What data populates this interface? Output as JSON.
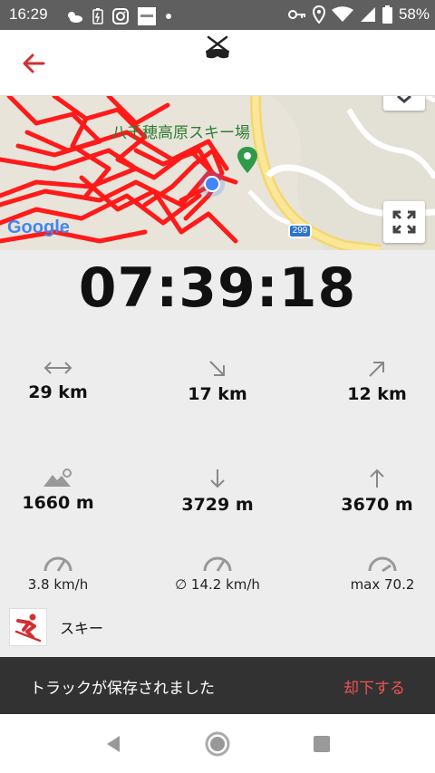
{
  "status_bar": {
    "time": "16:29",
    "battery": "58%",
    "left_icons": [
      "weather-icon",
      "battery-saver-icon",
      "instagram-icon",
      "app-icon",
      "dot-icon"
    ],
    "right_icons": [
      "key-icon",
      "location-icon",
      "wifi-icon",
      "signal-icon",
      "battery-icon"
    ]
  },
  "header": {
    "back_icon": "arrow-left-icon",
    "logo_icon": "ski-goggles-logo-icon"
  },
  "map": {
    "place_label": "八千穂高原スキー場",
    "google_label": "Google",
    "route_number": "299",
    "expand_icon": "fullscreen-icon"
  },
  "timer": "07:39:18",
  "stats": {
    "distance": "29 km",
    "downhill_distance": "17 km",
    "uphill_distance": "12 km",
    "max_altitude": "1660 m",
    "descent": "3729 m",
    "ascent": "3670 m",
    "speed_current": "3.8 km/h",
    "speed_avg": "∅ 14.2 km/h",
    "speed_max": "max 70.2"
  },
  "activity": {
    "label": "スキー",
    "icon": "skier-icon"
  },
  "snackbar": {
    "message": "トラックが保存されました",
    "action": "却下する"
  },
  "nav": {
    "back_icon": "nav-back-icon",
    "home_icon": "nav-home-icon",
    "recents_icon": "nav-recents-icon"
  },
  "colors": {
    "accent": "#d32f2f",
    "track": "#ff1a1a",
    "snackbar_bg": "#323232",
    "snackbar_action": "#ef5350"
  }
}
